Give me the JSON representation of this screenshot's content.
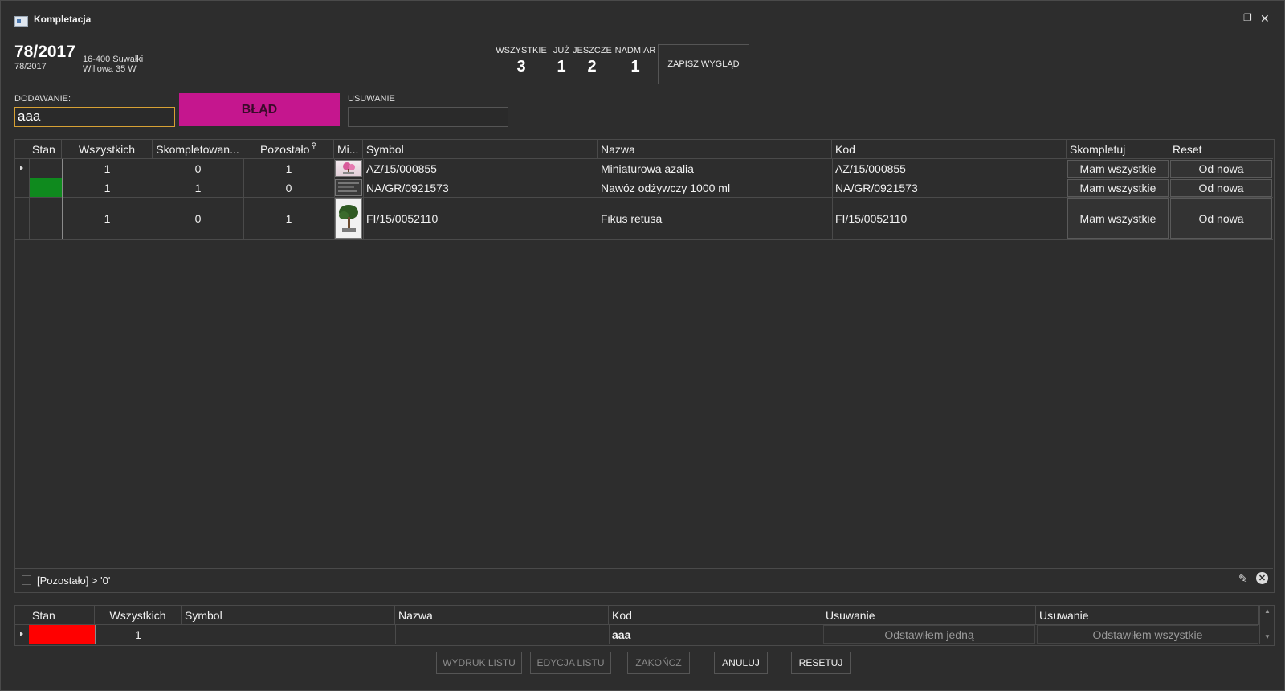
{
  "window": {
    "title": "Kompletacja",
    "icon": "window-icon",
    "controls": [
      "minimize-icon",
      "restore-icon",
      "close-icon"
    ]
  },
  "header": {
    "number": "78/2017",
    "sub_number": "78/2017",
    "address_line1": "16-400 Suwałki",
    "address_line2": "Willowa 35 W"
  },
  "stats": [
    {
      "label": "WSZYSTKIE",
      "value": "3"
    },
    {
      "label": "JUŻ",
      "value": "1"
    },
    {
      "label": "JESZCZE",
      "value": "2"
    },
    {
      "label": "NADMIAR",
      "value": "1"
    }
  ],
  "save_layout_label": "ZAPISZ WYGLĄD",
  "adding": {
    "label": "DODAWANIE:",
    "value": "aaa"
  },
  "status_button_label": "BŁĄD",
  "status_color": "#c5168e",
  "removing": {
    "label": "USUWANIE",
    "value": ""
  },
  "main_grid": {
    "columns": [
      "Stan",
      "Wszystkich",
      "Skompletowan...",
      "Pozostało",
      "Mi...",
      "Symbol",
      "Nazwa",
      "Kod",
      "Skompletuj",
      "Reset"
    ],
    "rows": [
      {
        "state_color": "",
        "all": "1",
        "done": "0",
        "left": "1",
        "thumb": "azalea-thumbnail",
        "symbol": "AZ/15/000855",
        "name": "Miniaturowa azalia",
        "code": "AZ/15/000855",
        "complete_label": "Mam wszystkie",
        "reset_label": "Od nowa"
      },
      {
        "state_color": "#0f8a1e",
        "all": "1",
        "done": "1",
        "left": "0",
        "thumb": "fertilizer-thumbnail",
        "symbol": "NA/GR/0921573",
        "name": "Nawóz odżywczy 1000 ml",
        "code": "NA/GR/0921573",
        "complete_label": "Mam wszystkie",
        "reset_label": "Od nowa"
      },
      {
        "state_color": "",
        "all": "1",
        "done": "0",
        "left": "1",
        "thumb": "ficus-thumbnail",
        "symbol": "FI/15/0052110",
        "name": "Fikus retusa",
        "code": "FI/15/0052110",
        "complete_label": "Mam wszystkie",
        "reset_label": "Od nowa"
      }
    ],
    "filter_text": "[Pozostało] > '0'"
  },
  "removal_grid": {
    "columns": [
      "Stan",
      "Wszystkich",
      "Symbol",
      "Nazwa",
      "Kod",
      "Usuwanie",
      "Usuwanie"
    ],
    "rows": [
      {
        "state_color": "#ff0000",
        "all": "1",
        "symbol": "",
        "name": "",
        "code": "aaa",
        "remove_one_label": "Odstawiłem jedną",
        "remove_all_label": "Odstawiłem wszystkie"
      }
    ]
  },
  "footer_buttons": {
    "print": "WYDRUK LISTU",
    "edit": "EDYCJA LISTU",
    "finish": "ZAKOŃCZ",
    "cancel": "ANULUJ",
    "reset": "RESETUJ"
  }
}
